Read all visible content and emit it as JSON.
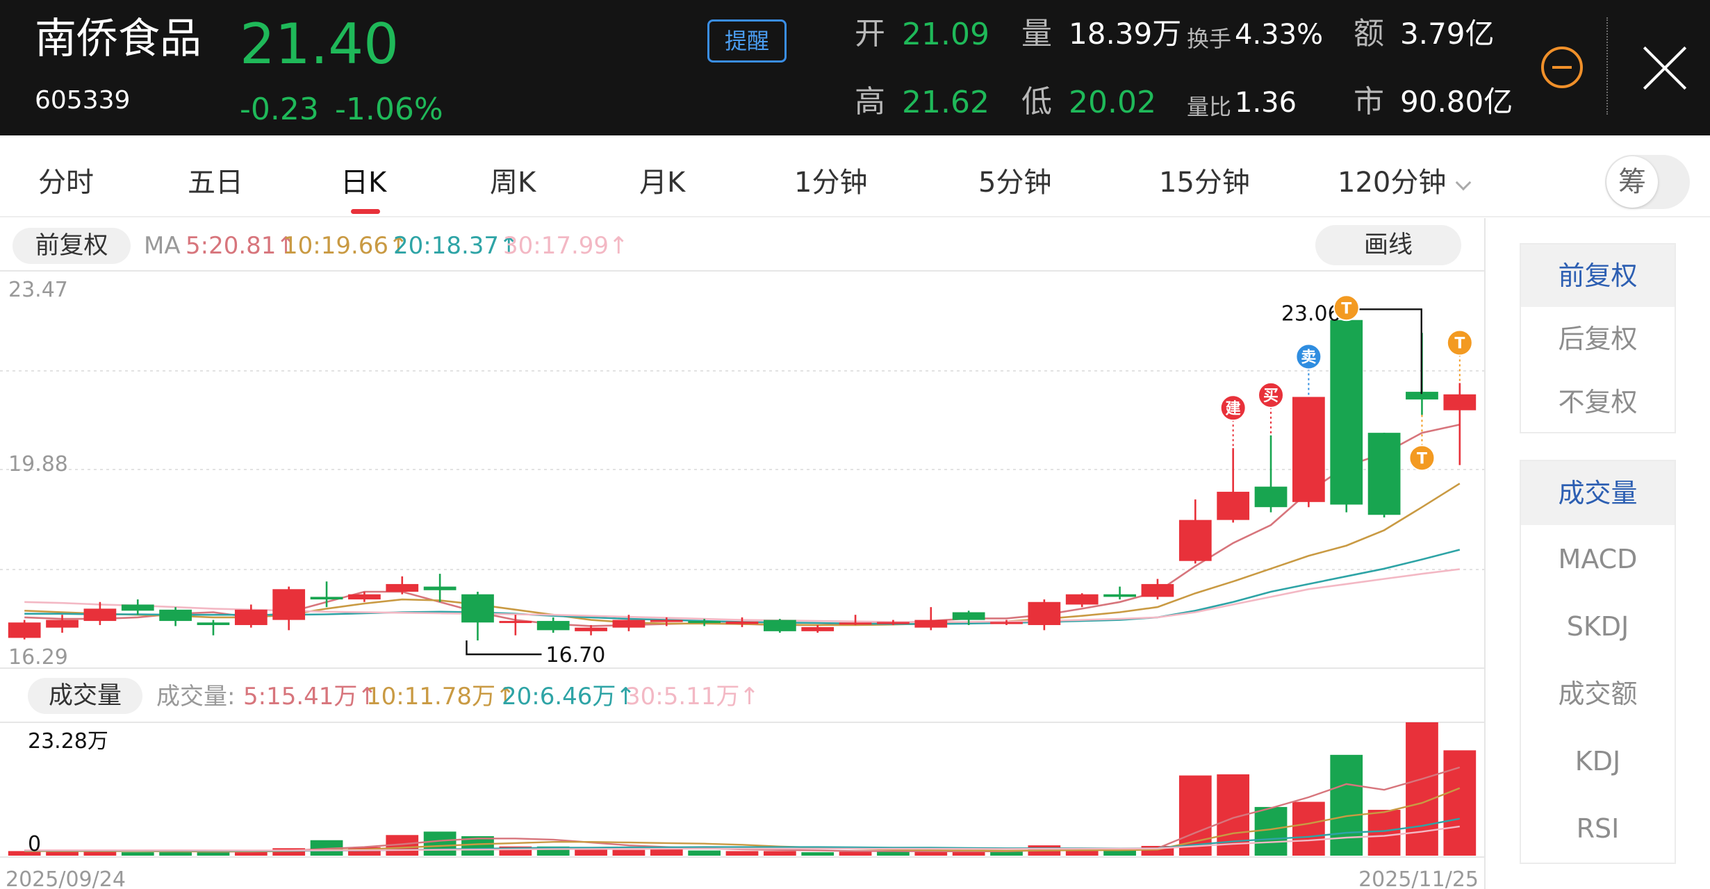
{
  "stock": {
    "name": "南侨食品",
    "code": "605339",
    "price": "21.40",
    "change": "-0.23",
    "change_pct": "-1.06%",
    "alert_label": "提醒"
  },
  "quote": {
    "open_label": "开",
    "open": "21.09",
    "high_label": "高",
    "high": "21.62",
    "volume_label": "量",
    "volume": "18.39万",
    "low_label": "低",
    "low": "20.02",
    "turnover_label": "换手",
    "turnover": "4.33%",
    "volratio_label": "量比",
    "volratio": "1.36",
    "amount_label": "额",
    "amount": "3.79亿",
    "mktcap_label": "市",
    "mktcap": "90.80亿"
  },
  "colors": {
    "up": "#e8313a",
    "down": "#18a550",
    "ma5": "#d7757c",
    "ma10": "#c99a43",
    "ma20": "#2ea4a6",
    "ma30": "#f3b8c4",
    "accent": "#2d5fb2"
  },
  "tabs": [
    {
      "label": "分时"
    },
    {
      "label": "五日"
    },
    {
      "label": "日K",
      "active": true
    },
    {
      "label": "周K"
    },
    {
      "label": "月K"
    },
    {
      "label": "1分钟"
    },
    {
      "label": "5分钟"
    },
    {
      "label": "15分钟"
    },
    {
      "label": "120分钟",
      "dropdown": true
    }
  ],
  "chip_toggle_label": "筹",
  "chart_header": {
    "adjust_label": "前复权",
    "ma_prefix": "MA",
    "ma5": "5:20.81",
    "ma10": "10:19.66",
    "ma20": "20:18.37",
    "ma30": "30:17.99",
    "draw_label": "画线"
  },
  "volume_header": {
    "label": "成交量",
    "prefix": "成交量:",
    "ma5": "5:15.41万",
    "ma10": "10:11.78万",
    "ma20": "20:6.46万",
    "ma30": "30:5.11万"
  },
  "side_panel": {
    "adjust_options": [
      "前复权",
      "后复权",
      "不复权"
    ],
    "indicator_options": [
      "成交量",
      "MACD",
      "SKDJ",
      "成交额",
      "KDJ",
      "RSI"
    ]
  },
  "chart_data": [
    {
      "type": "candlestick",
      "y_top_label": "23.47",
      "y_mid_label": "19.88",
      "y_bottom_label": "16.29",
      "ylim": [
        16.29,
        23.47
      ],
      "grid": true,
      "x_start_label": "2025/09/24",
      "x_end_label": "2025/11/25",
      "annotations": {
        "high_value": "23.06",
        "low_value": "16.70"
      },
      "markers": [
        {
          "index": 32,
          "label": "建",
          "kind": "build",
          "position": "above"
        },
        {
          "index": 33,
          "label": "买",
          "kind": "buy",
          "position": "above"
        },
        {
          "index": 34,
          "label": "卖",
          "kind": "sell",
          "position": "above"
        },
        {
          "index": 35,
          "label": "T",
          "kind": "t",
          "position": "above"
        },
        {
          "index": 37,
          "label": "T",
          "kind": "t",
          "position": "below"
        },
        {
          "index": 38,
          "label": "T",
          "kind": "t",
          "position": "above"
        }
      ],
      "candles": [
        {
          "o": 16.65,
          "c": 16.95,
          "h": 17.0,
          "l": 16.62
        },
        {
          "o": 16.85,
          "c": 17.0,
          "h": 17.1,
          "l": 16.75
        },
        {
          "o": 16.98,
          "c": 17.22,
          "h": 17.35,
          "l": 16.9
        },
        {
          "o": 17.3,
          "c": 17.18,
          "h": 17.4,
          "l": 17.1
        },
        {
          "o": 17.2,
          "c": 16.98,
          "h": 17.25,
          "l": 16.88
        },
        {
          "o": 16.95,
          "c": 16.9,
          "h": 17.0,
          "l": 16.7
        },
        {
          "o": 16.9,
          "c": 17.2,
          "h": 17.3,
          "l": 16.85
        },
        {
          "o": 17.0,
          "c": 17.6,
          "h": 17.65,
          "l": 16.8
        },
        {
          "o": 17.45,
          "c": 17.4,
          "h": 17.75,
          "l": 17.25
        },
        {
          "o": 17.4,
          "c": 17.5,
          "h": 17.55,
          "l": 17.35
        },
        {
          "o": 17.55,
          "c": 17.7,
          "h": 17.85,
          "l": 17.5
        },
        {
          "o": 17.65,
          "c": 17.58,
          "h": 17.9,
          "l": 17.35
        },
        {
          "o": 17.5,
          "c": 16.95,
          "h": 17.55,
          "l": 16.6
        },
        {
          "o": 16.95,
          "c": 16.98,
          "h": 17.1,
          "l": 16.7
        },
        {
          "o": 16.98,
          "c": 16.8,
          "h": 17.05,
          "l": 16.75
        },
        {
          "o": 16.78,
          "c": 16.85,
          "h": 16.9,
          "l": 16.7
        },
        {
          "o": 16.85,
          "c": 17.0,
          "h": 17.1,
          "l": 16.78
        },
        {
          "o": 16.98,
          "c": 17.0,
          "h": 17.05,
          "l": 16.88
        },
        {
          "o": 16.98,
          "c": 16.94,
          "h": 17.02,
          "l": 16.88
        },
        {
          "o": 16.92,
          "c": 16.97,
          "h": 17.05,
          "l": 16.86
        },
        {
          "o": 17.0,
          "c": 16.78,
          "h": 17.02,
          "l": 16.75
        },
        {
          "o": 16.78,
          "c": 16.86,
          "h": 16.9,
          "l": 16.75
        },
        {
          "o": 16.92,
          "c": 16.95,
          "h": 17.1,
          "l": 16.9
        },
        {
          "o": 16.94,
          "c": 16.96,
          "h": 17.0,
          "l": 16.9
        },
        {
          "o": 16.85,
          "c": 17.0,
          "h": 17.25,
          "l": 16.8
        },
        {
          "o": 17.15,
          "c": 17.0,
          "h": 17.18,
          "l": 16.9
        },
        {
          "o": 16.94,
          "c": 16.96,
          "h": 17.0,
          "l": 16.9
        },
        {
          "o": 16.9,
          "c": 17.35,
          "h": 17.4,
          "l": 16.8
        },
        {
          "o": 17.3,
          "c": 17.5,
          "h": 17.52,
          "l": 17.25
        },
        {
          "o": 17.5,
          "c": 17.45,
          "h": 17.65,
          "l": 17.4
        },
        {
          "o": 17.45,
          "c": 17.7,
          "h": 17.8,
          "l": 17.4
        },
        {
          "o": 18.15,
          "c": 18.95,
          "h": 19.35,
          "l": 18.1
        },
        {
          "o": 18.95,
          "c": 19.5,
          "h": 20.35,
          "l": 18.9
        },
        {
          "o": 19.6,
          "c": 19.2,
          "h": 20.6,
          "l": 19.1
        },
        {
          "o": 19.3,
          "c": 21.35,
          "h": 21.35,
          "l": 19.2
        },
        {
          "o": 22.85,
          "c": 19.25,
          "h": 23.06,
          "l": 19.1
        },
        {
          "o": 20.65,
          "c": 19.05,
          "h": 20.65,
          "l": 19.0
        },
        {
          "o": 21.45,
          "c": 21.3,
          "h": 22.6,
          "l": 21.0
        },
        {
          "o": 21.09,
          "c": 21.4,
          "h": 21.62,
          "l": 20.02
        }
      ],
      "ma": {
        "ma5": [
          17.05,
          17.02,
          17.02,
          17.05,
          17.12,
          17.15,
          17.05,
          17.15,
          17.35,
          17.55,
          17.55,
          17.35,
          17.15,
          17.0,
          16.92,
          16.88,
          16.9,
          16.92,
          16.94,
          16.92,
          16.9,
          16.9,
          16.92,
          16.94,
          16.98,
          17.03,
          17.03,
          17.1,
          17.22,
          17.35,
          17.55,
          18.05,
          18.5,
          18.85,
          19.5,
          20.0,
          20.25,
          20.65,
          20.81
        ],
        "ma10": [
          17.18,
          17.15,
          17.12,
          17.1,
          17.08,
          17.05,
          17.05,
          17.1,
          17.22,
          17.32,
          17.4,
          17.38,
          17.3,
          17.2,
          17.1,
          17.0,
          16.95,
          16.93,
          16.93,
          16.92,
          16.91,
          16.9,
          16.9,
          16.91,
          16.93,
          16.95,
          16.97,
          17.02,
          17.08,
          17.15,
          17.25,
          17.52,
          17.75,
          18.0,
          18.25,
          18.45,
          18.75,
          19.2,
          19.66
        ],
        "ma20": [
          17.12,
          17.12,
          17.11,
          17.11,
          17.1,
          17.1,
          17.1,
          17.1,
          17.11,
          17.13,
          17.15,
          17.16,
          17.15,
          17.12,
          17.08,
          17.05,
          17.02,
          17.0,
          16.98,
          16.96,
          16.95,
          16.94,
          16.93,
          16.92,
          16.92,
          16.93,
          16.94,
          16.96,
          16.98,
          17.0,
          17.05,
          17.18,
          17.35,
          17.55,
          17.7,
          17.85,
          18.0,
          18.18,
          18.37
        ],
        "ma30": [
          17.35,
          17.33,
          17.3,
          17.28,
          17.25,
          17.22,
          17.2,
          17.18,
          17.16,
          17.15,
          17.14,
          17.13,
          17.12,
          17.11,
          17.1,
          17.08,
          17.06,
          17.04,
          17.02,
          17.0,
          16.99,
          16.98,
          16.97,
          16.96,
          16.96,
          16.96,
          16.97,
          16.98,
          17.0,
          17.02,
          17.05,
          17.15,
          17.3,
          17.45,
          17.6,
          17.7,
          17.8,
          17.9,
          17.99
        ]
      }
    },
    {
      "type": "bar",
      "y_top_label": "23.28万",
      "y_bottom_label": "0",
      "ylim": [
        0,
        23.28
      ],
      "values": [
        0.8,
        0.7,
        0.9,
        0.6,
        0.6,
        0.6,
        0.7,
        1.3,
        2.7,
        1.5,
        3.6,
        4.2,
        3.4,
        1.6,
        1.6,
        1.2,
        1.0,
        1.1,
        0.9,
        0.8,
        0.8,
        0.6,
        0.7,
        0.7,
        0.8,
        0.7,
        0.7,
        1.8,
        1.3,
        0.9,
        1.7,
        14.0,
        14.2,
        8.5,
        9.4,
        17.6,
        8.0,
        23.28,
        18.39
      ],
      "up": [
        true,
        true,
        true,
        false,
        false,
        false,
        true,
        true,
        false,
        true,
        true,
        false,
        false,
        true,
        false,
        true,
        true,
        true,
        false,
        true,
        true,
        false,
        true,
        false,
        true,
        true,
        false,
        true,
        true,
        false,
        true,
        true,
        true,
        false,
        true,
        false,
        true,
        true,
        true
      ],
      "ma": {
        "ma5": [
          0.8,
          0.8,
          0.8,
          0.8,
          0.75,
          0.7,
          0.7,
          0.85,
          1.2,
          1.5,
          2.0,
          2.6,
          3.0,
          3.0,
          2.8,
          2.3,
          1.8,
          1.5,
          1.3,
          1.1,
          1.0,
          0.9,
          0.8,
          0.8,
          0.75,
          0.75,
          0.75,
          0.95,
          1.05,
          1.1,
          1.3,
          4.0,
          6.6,
          8.3,
          10.2,
          12.5,
          11.5,
          13.4,
          15.41
        ],
        "ma10": [
          0.8,
          0.8,
          0.8,
          0.8,
          0.78,
          0.75,
          0.75,
          0.8,
          0.95,
          1.1,
          1.4,
          1.7,
          2.0,
          2.2,
          2.4,
          2.4,
          2.3,
          2.2,
          2.1,
          1.9,
          1.6,
          1.4,
          1.2,
          1.05,
          0.95,
          0.9,
          0.85,
          0.9,
          0.95,
          0.95,
          1.05,
          2.5,
          3.9,
          4.6,
          5.6,
          6.9,
          7.6,
          9.2,
          11.78
        ],
        "ma20": [
          0.9,
          0.9,
          0.9,
          0.9,
          0.88,
          0.86,
          0.85,
          0.85,
          0.88,
          0.92,
          1.0,
          1.1,
          1.2,
          1.3,
          1.4,
          1.4,
          1.45,
          1.45,
          1.5,
          1.5,
          1.5,
          1.5,
          1.45,
          1.4,
          1.4,
          1.35,
          1.3,
          1.3,
          1.3,
          1.25,
          1.3,
          1.9,
          2.5,
          2.9,
          3.3,
          4.0,
          4.3,
          5.2,
          6.46
        ],
        "ma30": [
          0.95,
          0.95,
          0.95,
          0.95,
          0.94,
          0.93,
          0.92,
          0.92,
          0.93,
          0.95,
          0.98,
          1.02,
          1.06,
          1.1,
          1.14,
          1.16,
          1.18,
          1.2,
          1.22,
          1.22,
          1.22,
          1.22,
          1.22,
          1.2,
          1.2,
          1.19,
          1.18,
          1.2,
          1.22,
          1.22,
          1.25,
          1.65,
          2.05,
          2.35,
          2.65,
          3.15,
          3.45,
          4.2,
          5.11
        ]
      }
    }
  ]
}
